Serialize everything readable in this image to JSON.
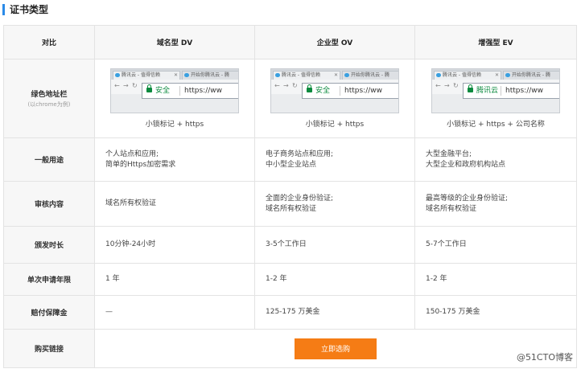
{
  "section": {
    "title": "证书类型"
  },
  "table": {
    "headers": [
      "对比",
      "域名型 DV",
      "企业型 OV",
      "增强型 EV"
    ],
    "address_bar": {
      "label": "绿色地址栏",
      "sublabel": "(以chrome为例)",
      "browsers": [
        {
          "tab1": "腾讯云 - 值得信赖",
          "tab2": "开始你腾讯云 - 腾",
          "safe_text": "安全",
          "url_text": "https://ww",
          "caption": "小锁标记 + https"
        },
        {
          "tab1": "腾讯云 - 值得信赖",
          "tab2": "开始你腾讯云 - 腾",
          "safe_text": "安全",
          "url_text": "https://ww",
          "caption": "小锁标记 + https"
        },
        {
          "tab1": "腾讯云 - 值得信赖",
          "tab2": "开始你腾讯云 - 腾",
          "safe_text": "腾讯云",
          "url_text": "https://ww",
          "caption": "小锁标记 + https + 公司名称"
        }
      ]
    },
    "rows": [
      {
        "label": "一般用途",
        "cells": [
          [
            "个人站点和应用;",
            "简单的Https加密需求"
          ],
          [
            "电子商务站点和应用;",
            "中小型企业站点"
          ],
          [
            "大型金融平台;",
            "大型企业和政府机构站点"
          ]
        ]
      },
      {
        "label": "审核内容",
        "cells": [
          [
            "域名所有权验证"
          ],
          [
            "全面的企业身份验证;",
            "域名所有权验证"
          ],
          [
            "最高等级的企业身份验证;",
            "域名所有权验证"
          ]
        ]
      },
      {
        "label": "颁发时长",
        "cells": [
          [
            "10分钟-24小时"
          ],
          [
            "3-5个工作日"
          ],
          [
            "5-7个工作日"
          ]
        ]
      },
      {
        "label": "单次申请年限",
        "cells": [
          [
            "1 年"
          ],
          [
            "1-2 年"
          ],
          [
            "1-2 年"
          ]
        ]
      },
      {
        "label": "赔付保障金",
        "cells": [
          [
            "—"
          ],
          [
            "125-175 万美金"
          ],
          [
            "150-175 万美金"
          ]
        ]
      }
    ],
    "buy": {
      "label": "购买链接",
      "button_label": "立即选购"
    }
  },
  "icons": {
    "lock": "lock-icon",
    "tab_favicon": "cloud-icon",
    "tab_close": "close-icon",
    "nav_back": "arrow-left-icon",
    "nav_forward": "arrow-right-icon",
    "nav_reload": "reload-icon"
  },
  "colors": {
    "accent": "#2b8be8",
    "button": "#f57c15",
    "secure_green": "#0b8a3e"
  },
  "watermark": "@51CTO博客"
}
